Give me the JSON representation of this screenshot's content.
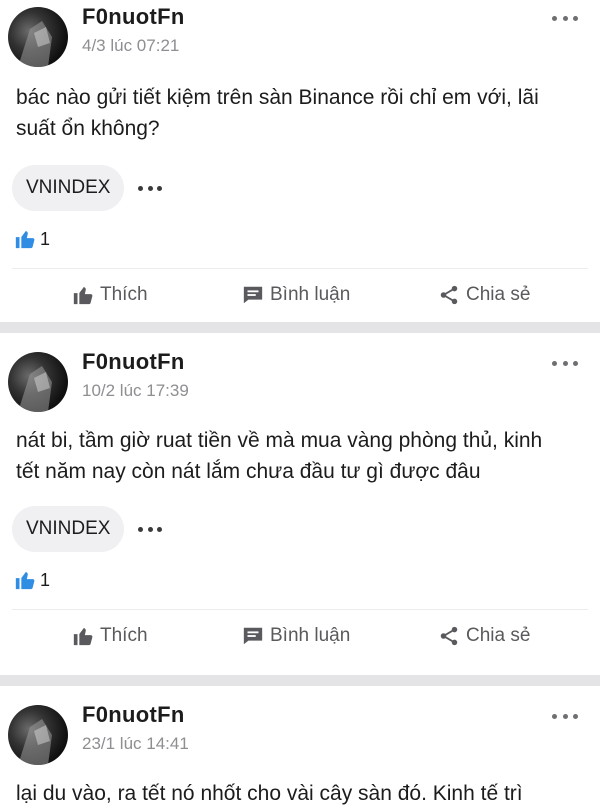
{
  "posts": [
    {
      "username": "F0nuotFn",
      "timestamp": "4/3 lúc 07:21",
      "text": "bác nào gửi tiết kiệm trên sàn Binance rồi chỉ em với, lãi suất ổn không?",
      "tag": "VNINDEX",
      "likes": "1"
    },
    {
      "username": "F0nuotFn",
      "timestamp": "10/2 lúc 17:39",
      "text": "nát bi, tầm giờ ruat tiền về mà mua vàng phòng thủ, kinh tết năm nay còn nát lắm chưa đầu tư gì được đâu",
      "tag": "VNINDEX",
      "likes": "1"
    },
    {
      "username": "F0nuotFn",
      "timestamp": "23/1 lúc 14:41",
      "text": "lại du vào, ra tết nó nhốt cho vài cây sàn đó. Kinh tế trì"
    }
  ],
  "actions": {
    "like": "Thích",
    "comment": "Bình luận",
    "share": "Chia sẻ"
  },
  "colors": {
    "like_blue": "#2f8de4",
    "muted": "#8e8e93",
    "separator": "#e4e4e6"
  },
  "icons": [
    "more-horizontal-icon",
    "thumbs-up-icon",
    "comment-icon",
    "share-icon"
  ]
}
